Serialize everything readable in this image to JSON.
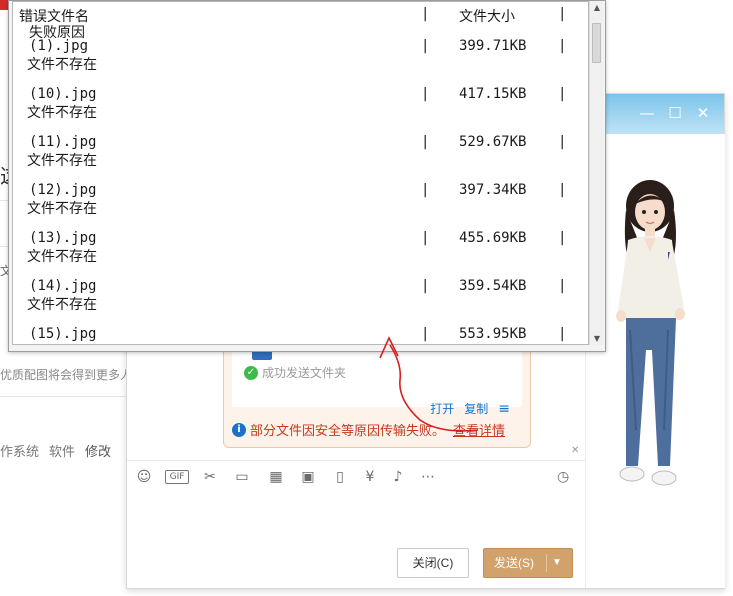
{
  "background_page": {
    "side_texts": [
      "这",
      "文",
      "优质配图将会得到更多人"
    ],
    "category_links": [
      "作系统",
      "软件",
      "修改"
    ]
  },
  "error_dialog": {
    "header": {
      "col_name": "错误文件名",
      "col_size": "文件大小"
    },
    "reason_header": "失败原因",
    "rows": [
      {
        "name": "(1).jpg",
        "size": "399.71KB",
        "reason": "文件不存在"
      },
      {
        "name": "(10).jpg",
        "size": "417.15KB",
        "reason": "文件不存在"
      },
      {
        "name": "(11).jpg",
        "size": "529.67KB",
        "reason": "文件不存在"
      },
      {
        "name": "(12).jpg",
        "size": "397.34KB",
        "reason": "文件不存在"
      },
      {
        "name": "(13).jpg",
        "size": "455.69KB",
        "reason": "文件不存在"
      },
      {
        "name": "(14).jpg",
        "size": "359.54KB",
        "reason": "文件不存在"
      },
      {
        "name": "(15).jpg",
        "size": "553.95KB",
        "reason": ""
      }
    ],
    "separator": "|"
  },
  "chat": {
    "title_buttons": {
      "minimize": "—",
      "maximize": "☐",
      "close": "✕"
    },
    "file_card": {
      "status": "成功发送文件夹",
      "open": "打开",
      "copy": "复制",
      "warning": "部分文件因安全等原因传输失败。",
      "details_link": "查看详情"
    },
    "toolbar_icons": [
      "smiley-icon",
      "gif-icon",
      "scissors-icon",
      "folder-icon",
      "font-icon",
      "image-icon",
      "shake-icon",
      "red-packet-icon",
      "music-icon",
      "more-icon"
    ],
    "close_button": "关闭(C)",
    "send_button": "发送(S)"
  },
  "colors": {
    "accent": "#d2a26c",
    "link": "#1a73c9",
    "warning": "#c43a1d",
    "titlebar": "#7cc4ea"
  }
}
